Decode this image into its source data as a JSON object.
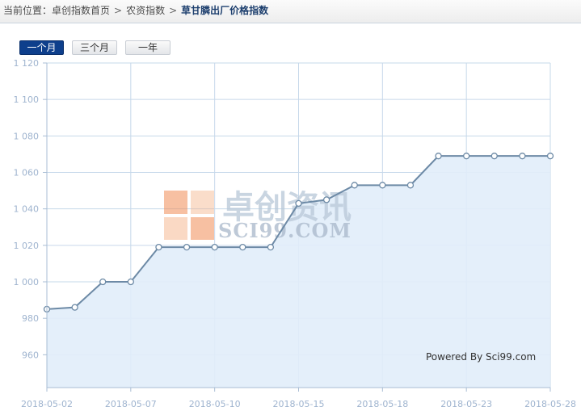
{
  "breadcrumb": {
    "prefix": "当前位置：",
    "items": [
      "卓创指数首页",
      "农资指数"
    ],
    "separator": ">",
    "current": "草甘膦出厂价格指数"
  },
  "tabs": [
    {
      "label": "一个月",
      "active": true
    },
    {
      "label": "三个月",
      "active": false
    },
    {
      "label": "一年",
      "active": false
    }
  ],
  "watermark": {
    "cn": "卓创资讯",
    "en": "SCI99.COM"
  },
  "credit": "Powered By Sci99.com",
  "colors": {
    "line": "#6d8aa6",
    "area": "#e1edf9",
    "grid": "#c6d8ea",
    "tab_active": "#0e3f8c",
    "logo": "#f08c55"
  },
  "chart_data": {
    "type": "area",
    "title": "",
    "xlabel": "",
    "ylabel": "",
    "x": [
      "2018-05-02",
      "2018-05-03",
      "2018-05-04",
      "2018-05-07",
      "2018-05-08",
      "2018-05-09",
      "2018-05-10",
      "2018-05-11",
      "2018-05-14",
      "2018-05-15",
      "2018-05-16",
      "2018-05-17",
      "2018-05-18",
      "2018-05-21",
      "2018-05-22",
      "2018-05-23",
      "2018-05-24",
      "2018-05-25",
      "2018-05-28"
    ],
    "series": [
      {
        "values": [
          985,
          986,
          1000,
          1000,
          1019,
          1019,
          1019,
          1019,
          1019,
          1043,
          1045,
          1053,
          1053,
          1053,
          1069,
          1069,
          1069,
          1069,
          1069
        ]
      }
    ],
    "x_tick_labels": [
      "2018-05-02",
      "2018-05-07",
      "2018-05-10",
      "2018-05-15",
      "2018-05-18",
      "2018-05-23",
      "2018-05-28"
    ],
    "y_tick_labels": [
      "960",
      "980",
      "1 000",
      "1 020",
      "1 040",
      "1 060",
      "1 080",
      "1 100",
      "1 120"
    ],
    "ylim": [
      942,
      1120
    ],
    "grid": true,
    "legend": "none"
  }
}
